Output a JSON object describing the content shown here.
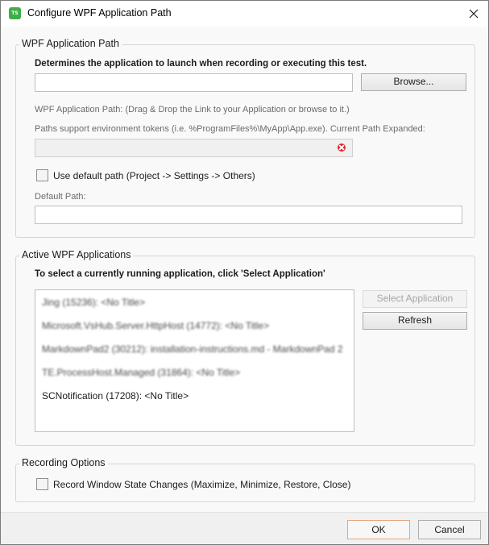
{
  "window": {
    "title": "Configure WPF Application Path",
    "app_icon_text": "TS",
    "app_icon_color": "#3fae49"
  },
  "app_path_group": {
    "title": "WPF Application Path",
    "description": "Determines the application to launch when recording or executing this test.",
    "path_value": "",
    "browse_label": "Browse...",
    "drag_drop_hint": "WPF Application Path: (Drag & Drop the Link to your Application or browse to it.)",
    "env_tokens_hint": "Paths support environment tokens (i.e. %ProgramFiles%\\MyApp\\App.exe). Current Path Expanded:",
    "expanded_path_value": "",
    "use_default_label": "Use default path (Project -> Settings -> Others)",
    "use_default_checked": false,
    "default_path_label": "Default Path:",
    "default_path_value": ""
  },
  "active_apps_group": {
    "title": "Active WPF Applications",
    "instruction": "To select a currently running application, click 'Select Application'",
    "select_label": "Select Application",
    "refresh_label": "Refresh",
    "applications": [
      "Jing (15236): <No Title>",
      "Microsoft.VsHub.Server.HttpHost (14772): <No Title>",
      "MarkdownPad2 (30212): installation-instructions.md - MarkdownPad 2",
      "TE.ProcessHost.Managed (31864): <No Title>",
      "SCNotification (17208): <No Title>"
    ]
  },
  "recording_group": {
    "title": "Recording Options",
    "record_state_label": "Record Window State Changes (Maximize, Minimize, Restore, Close)",
    "record_state_checked": false
  },
  "footer": {
    "ok_label": "OK",
    "cancel_label": "Cancel"
  },
  "colors": {
    "error_icon": "#e3242b",
    "ok_border": "#e4a77f"
  }
}
